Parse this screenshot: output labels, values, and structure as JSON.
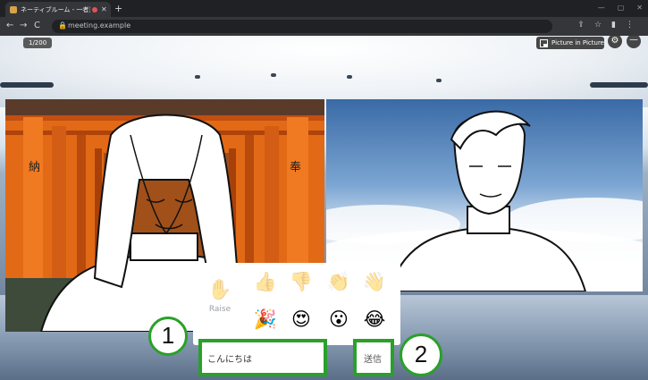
{
  "browser": {
    "tab_title": "ネーティブルーム - 一者対話室",
    "new_tab": "+",
    "window_controls": [
      "—",
      "▢",
      "✕"
    ],
    "nav": [
      "←",
      "→",
      "C"
    ],
    "url": "meeting.example",
    "toolbar_icons": [
      "share-icon",
      "star-icon",
      "extension-icon",
      "profile-icon"
    ]
  },
  "overlay": {
    "counter": "1/200",
    "pip_label": "Picture in Picture",
    "settings_glyph": "⚙",
    "more_glyph": "—"
  },
  "reactions": {
    "raise_label": "Raise",
    "raise_glyph": "✋",
    "row1": [
      "👍",
      "👎",
      "👏",
      "👋"
    ],
    "row2": [
      "🎉",
      "😍",
      "😮",
      "😂"
    ]
  },
  "chat": {
    "input_value": "こんにちは",
    "send_label": "送信"
  },
  "callouts": [
    "1",
    "2"
  ],
  "colors": {
    "highlight": "#2aa02a",
    "torii": "#e8721c"
  }
}
